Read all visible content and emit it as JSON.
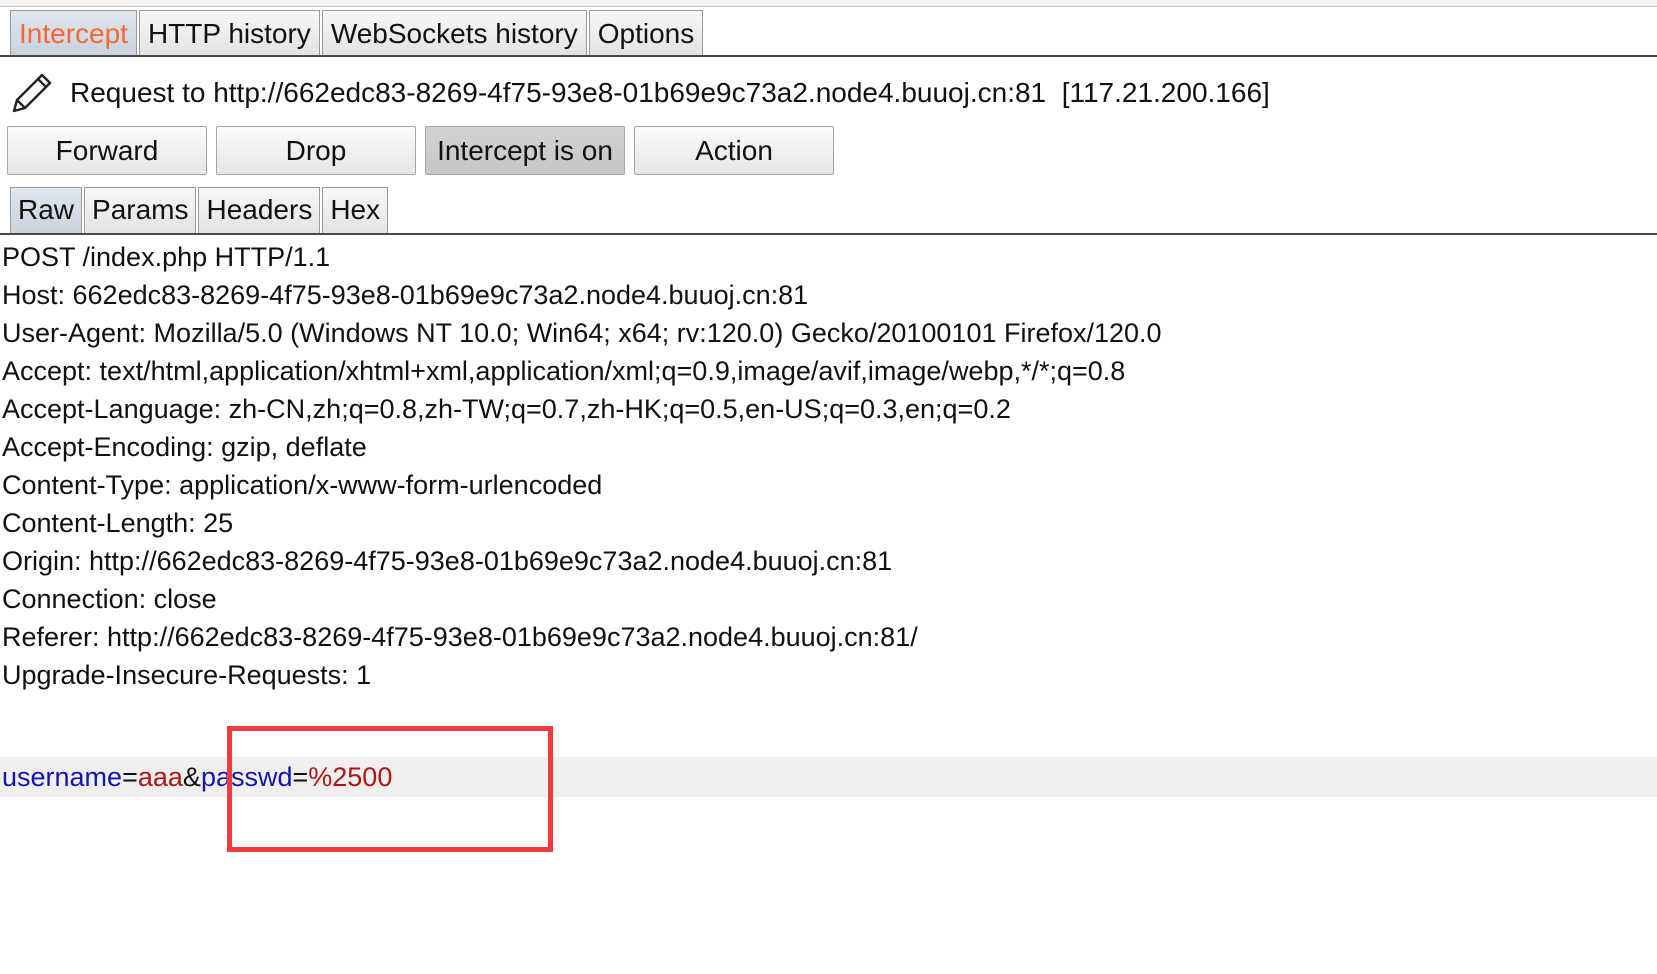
{
  "tabs": [
    {
      "label": "Intercept",
      "active": true
    },
    {
      "label": "HTTP history"
    },
    {
      "label": "WebSockets history"
    },
    {
      "label": "Options"
    }
  ],
  "request_line": {
    "label": "Request to http://662edc83-8269-4f75-93e8-01b69e9c73a2.node4.buuoj.cn:81",
    "ip": "[117.21.200.166]"
  },
  "buttons": {
    "forward": "Forward",
    "drop": "Drop",
    "intercept": "Intercept is on",
    "action": "Action"
  },
  "subtabs": [
    "Raw",
    "Params",
    "Headers",
    "Hex"
  ],
  "raw_lines": [
    "POST /index.php HTTP/1.1",
    "Host: 662edc83-8269-4f75-93e8-01b69e9c73a2.node4.buuoj.cn:81",
    "User-Agent: Mozilla/5.0 (Windows NT 10.0; Win64; x64; rv:120.0) Gecko/20100101 Firefox/120.0",
    "Accept: text/html,application/xhtml+xml,application/xml;q=0.9,image/avif,image/webp,*/*;q=0.8",
    "Accept-Language: zh-CN,zh;q=0.8,zh-TW;q=0.7,zh-HK;q=0.5,en-US;q=0.3,en;q=0.2",
    "Accept-Encoding: gzip, deflate",
    "Content-Type: application/x-www-form-urlencoded",
    "Content-Length: 25",
    "Origin: http://662edc83-8269-4f75-93e8-01b69e9c73a2.node4.buuoj.cn:81",
    "Connection: close",
    "Referer: http://662edc83-8269-4f75-93e8-01b69e9c73a2.node4.buuoj.cn:81/",
    "Upgrade-Insecure-Requests: 1"
  ],
  "body": {
    "k1": "username",
    "eq": "=",
    "v1": "aaa",
    "amp": "&",
    "k2": "passwd",
    "v2": "%2500"
  },
  "colors": {
    "active_tab_text": "#ff6633",
    "param_name": "#1515b0",
    "param_value": "#b01515",
    "highlight_box": "#f03c3c"
  },
  "icons": {
    "request": "pencil-icon"
  }
}
